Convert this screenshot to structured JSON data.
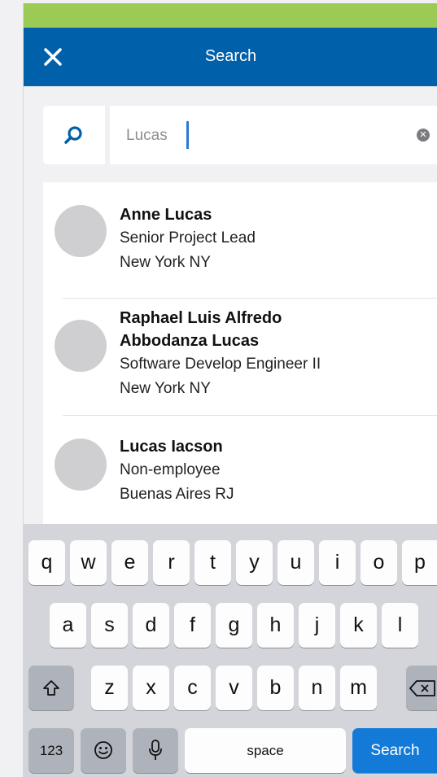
{
  "header": {
    "title": "Search",
    "close_icon": "close-icon"
  },
  "search": {
    "value": "Lucas",
    "icon": "search-icon",
    "clear_icon": "clear-icon"
  },
  "results": [
    {
      "name": "Anne Lucas",
      "title": "Senior Project Lead",
      "location": "New York NY"
    },
    {
      "name_line1": "Raphael Luis Alfredo",
      "name_line2": "Abbodanza Lucas",
      "title": "Software Develop Engineer II",
      "location": "New York NY"
    },
    {
      "name": "Lucas Iacson",
      "title": "Non-employee",
      "location": "Buenas Aires RJ"
    }
  ],
  "keyboard": {
    "row1": [
      "q",
      "w",
      "e",
      "r",
      "t",
      "y",
      "u",
      "i",
      "o",
      "p"
    ],
    "row2": [
      "a",
      "s",
      "d",
      "f",
      "g",
      "h",
      "j",
      "k",
      "l"
    ],
    "row3": [
      "z",
      "x",
      "c",
      "v",
      "b",
      "n",
      "m"
    ],
    "numbers_label": "123",
    "space_label": "space",
    "search_label": "Search",
    "shift_icon": "shift-icon",
    "delete_icon": "delete-icon",
    "emoji_icon": "emoji-icon",
    "mic_icon": "microphone-icon"
  },
  "colors": {
    "status_strip": "#9ccb55",
    "header": "#0060a9",
    "accent": "#137ad8"
  }
}
